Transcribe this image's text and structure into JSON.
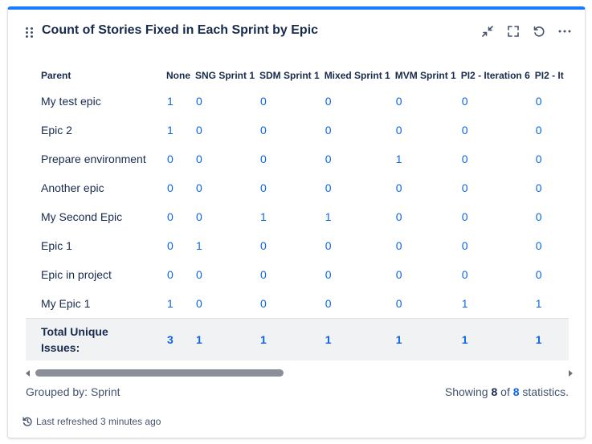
{
  "gadget": {
    "title": "Count of Stories Fixed in Each Sprint by Epic",
    "accent_color": "#1d7afc",
    "icons": [
      "drag-handle-icon",
      "minimize-icon",
      "fullscreen-icon",
      "refresh-icon",
      "more-icon"
    ]
  },
  "table": {
    "columns": [
      "Parent",
      "None",
      "SNG Sprint 1",
      "SDM Sprint 1",
      "Mixed Sprint 1",
      "MVM Sprint 1",
      "PI2 - Iteration 6",
      "PI2 - It"
    ],
    "rows": [
      {
        "label": "My test epic",
        "values": [
          "1",
          "0",
          "0",
          "0",
          "0",
          "0",
          "0"
        ]
      },
      {
        "label": "Epic 2",
        "values": [
          "1",
          "0",
          "0",
          "0",
          "0",
          "0",
          "0"
        ]
      },
      {
        "label": "Prepare environment",
        "values": [
          "0",
          "0",
          "0",
          "0",
          "1",
          "0",
          "0"
        ]
      },
      {
        "label": "Another epic",
        "values": [
          "0",
          "0",
          "0",
          "0",
          "0",
          "0",
          "0"
        ]
      },
      {
        "label": "My Second Epic",
        "values": [
          "0",
          "0",
          "1",
          "1",
          "0",
          "0",
          "0"
        ]
      },
      {
        "label": "Epic 1",
        "values": [
          "0",
          "1",
          "0",
          "0",
          "0",
          "0",
          "0"
        ]
      },
      {
        "label": "Epic in project",
        "values": [
          "0",
          "0",
          "0",
          "0",
          "0",
          "0",
          "0"
        ]
      },
      {
        "label": "My Epic 1",
        "values": [
          "1",
          "0",
          "0",
          "0",
          "0",
          "1",
          "1"
        ]
      }
    ],
    "total": {
      "label_line1": "Total Unique",
      "label_line2": "Issues:",
      "values": [
        "3",
        "1",
        "1",
        "1",
        "1",
        "1",
        "1"
      ]
    }
  },
  "footer": {
    "grouped_by": "Grouped by: Sprint",
    "showing_prefix": "Showing",
    "shown": "8",
    "of": "of",
    "total": "8",
    "suffix": "statistics.",
    "last_refreshed": "Last refreshed 3 minutes ago"
  }
}
